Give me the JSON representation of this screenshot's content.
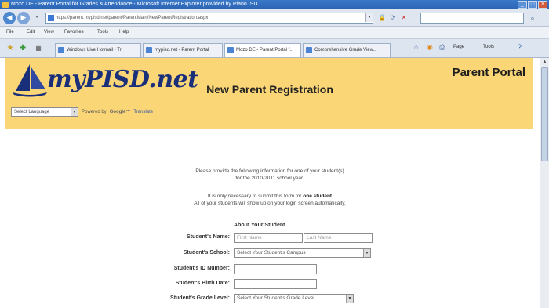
{
  "window": {
    "title": "Mozo DE - Parent Portal for Grades & Attendance - Microsoft Internet Explorer provided by Plano ISD",
    "minimize": "_",
    "maximize": "□",
    "close": "×"
  },
  "address_bar": {
    "url": "https://parent.mypisd.net/parent/ParentMain/NewParentRegistration.aspx",
    "go": "▾"
  },
  "menu": [
    "File",
    "Edit",
    "View",
    "Favorites",
    "Tools",
    "Help"
  ],
  "tabs": [
    {
      "label": "Windows Live Hotmail - Tr"
    },
    {
      "label": "mypisd.net - Parent Portal"
    },
    {
      "label": "Mozo DE - Parent Portal f..."
    },
    {
      "label": "Comprehensive Grade View..."
    }
  ],
  "commands": {
    "page": "Page",
    "tools": "Tools"
  },
  "header": {
    "logo_text": "myPISD.net",
    "portal_title": "Parent Portal",
    "language_select": "Select Language",
    "powered_by": "Powered by",
    "google": "Google™",
    "translate": "Translate"
  },
  "registration": {
    "title": "New Parent Registration",
    "instruction_line1": "Please provide the following information for one of your student(s)",
    "instruction_line2": "for the 2010-2011 school year.",
    "note_line1_prefix": "It is only necessary to submit this form for",
    "note_line1_bold": "one student",
    "note_line2": "All of your students will show up on your login screen automatically.",
    "about_label": "About Your Student",
    "fields": {
      "name_label": "Student's Name:",
      "first_placeholder": "First Name",
      "last_placeholder": "Last Name",
      "school_label": "Student's School:",
      "school_value": "Select Your Student's Campus",
      "id_label": "Student's ID Number:",
      "birth_label": "Student's Birth Date:",
      "grade_label": "Student's Grade Level:",
      "grade_value": "Select Your Student's Grade Level"
    }
  },
  "colors": {
    "header_band": "#fbd676",
    "logo_blue": "#1a2f7a",
    "titlebar": "#3a78c8"
  }
}
